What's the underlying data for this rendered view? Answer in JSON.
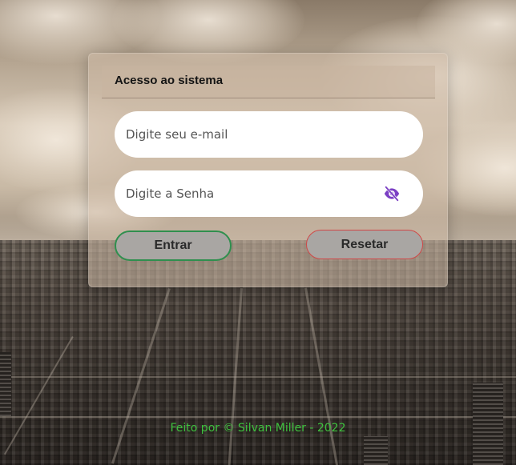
{
  "login": {
    "title": "Acesso ao sistema",
    "email_placeholder": "Digite seu e-mail",
    "email_value": "",
    "password_placeholder": "Digite a Senha",
    "password_value": "",
    "toggle_icon": "eye-slash-icon",
    "enter_label": "Entrar",
    "reset_label": "Resetar"
  },
  "footer": {
    "text": "Feito por © Silvan Miller - 2022"
  },
  "colors": {
    "accent_icon": "#7b3fc4",
    "enter_border": "#2f8f4e",
    "reset_border": "#d04848",
    "footer_text": "#3ec13e",
    "button_bg": "#a9a6a3"
  }
}
